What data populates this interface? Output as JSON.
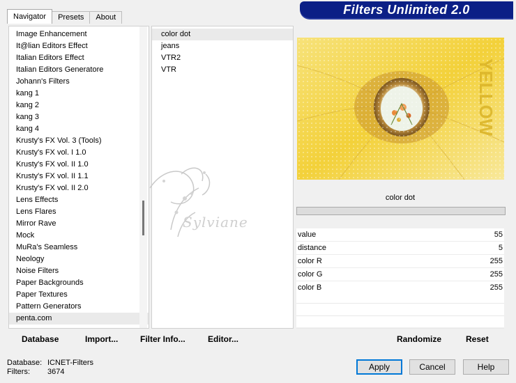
{
  "tabs": [
    {
      "label": "Navigator",
      "active": true
    },
    {
      "label": "Presets",
      "active": false
    },
    {
      "label": "About",
      "active": false
    }
  ],
  "banner": {
    "title": "Filters Unlimited 2.0"
  },
  "categories": [
    {
      "label": "Image Enhancement"
    },
    {
      "label": "It@lian Editors Effect"
    },
    {
      "label": "Italian Editors Effect"
    },
    {
      "label": "Italian Editors Generatore"
    },
    {
      "label": "Johann's Filters"
    },
    {
      "label": "kang 1"
    },
    {
      "label": "kang 2"
    },
    {
      "label": "kang 3"
    },
    {
      "label": "kang 4"
    },
    {
      "label": "Krusty's FX Vol. 3 (Tools)"
    },
    {
      "label": "Krusty's FX vol. I 1.0"
    },
    {
      "label": "Krusty's FX vol. II 1.0"
    },
    {
      "label": "Krusty's FX vol. II 1.1"
    },
    {
      "label": "Krusty's FX vol. II 2.0"
    },
    {
      "label": "Lens Effects"
    },
    {
      "label": "Lens Flares"
    },
    {
      "label": "Mirror Rave"
    },
    {
      "label": "Mock"
    },
    {
      "label": "MuRa's Seamless"
    },
    {
      "label": "Neology"
    },
    {
      "label": "Noise Filters"
    },
    {
      "label": "Paper Backgrounds"
    },
    {
      "label": "Paper Textures"
    },
    {
      "label": "Pattern Generators"
    },
    {
      "label": "penta.com",
      "selected": true
    }
  ],
  "filters": [
    {
      "label": "color dot",
      "selected": true
    },
    {
      "label": "jeans"
    },
    {
      "label": "VTR2"
    },
    {
      "label": "VTR"
    }
  ],
  "watermark": {
    "text": "Sylviane"
  },
  "preview": {
    "overlay_text": "YELLOW"
  },
  "filter_name": "color dot",
  "params": [
    {
      "label": "value",
      "value": "55"
    },
    {
      "label": "distance",
      "value": "5"
    },
    {
      "label": "color R",
      "value": "255"
    },
    {
      "label": "color G",
      "value": "255"
    },
    {
      "label": "color B",
      "value": "255"
    }
  ],
  "toolbar": {
    "database": "Database",
    "import": "Import...",
    "filter_info": "Filter Info...",
    "editor": "Editor...",
    "randomize": "Randomize",
    "reset": "Reset"
  },
  "status": {
    "database_label": "Database:",
    "database_value": "ICNET-Filters",
    "filters_label": "Filters:",
    "filters_value": "3674"
  },
  "buttons": {
    "apply": "Apply",
    "cancel": "Cancel",
    "help": "Help"
  }
}
